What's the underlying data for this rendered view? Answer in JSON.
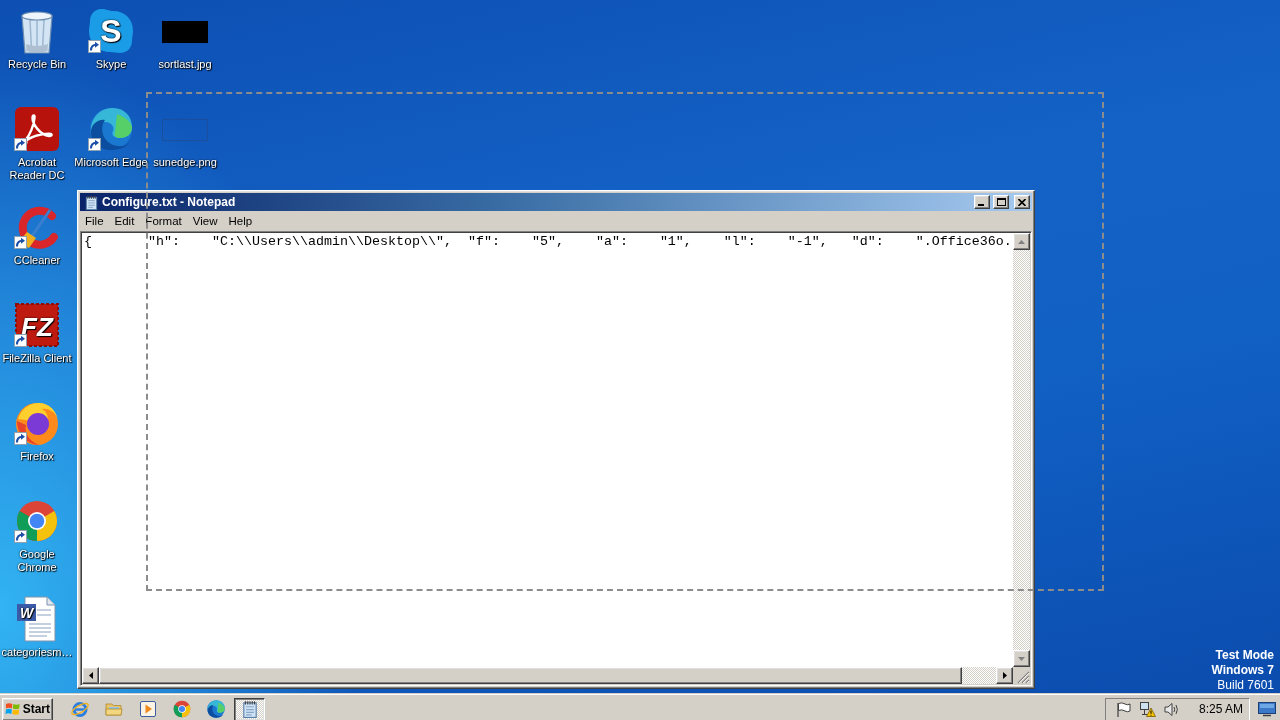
{
  "desktop": {
    "icon_columns": [
      [
        {
          "label": "Recycle Bin",
          "kind": "recycle_bin",
          "shortcut": false
        },
        {
          "label": "Acrobat Reader DC",
          "kind": "acrobat",
          "shortcut": true
        },
        {
          "label": "CCleaner",
          "kind": "ccleaner",
          "shortcut": true
        },
        {
          "label": "FileZilla Client",
          "kind": "filezilla",
          "logo_text": "FZ",
          "shortcut": true
        },
        {
          "label": "Firefox",
          "kind": "firefox",
          "shortcut": true
        },
        {
          "label": "Google Chrome",
          "kind": "chrome",
          "shortcut": true
        },
        {
          "label": "categoriesm…",
          "kind": "word_document",
          "logo_text": "W",
          "shortcut": false
        }
      ],
      [
        {
          "label": "Skype",
          "kind": "skype",
          "logo_text": "S",
          "shortcut": true
        },
        {
          "label": "Microsoft Edge",
          "kind": "edge",
          "shortcut": true
        }
      ],
      [
        {
          "label": "sortlast.jpg",
          "kind": "image_dark",
          "shortcut": false
        },
        {
          "label": "sunedge.png",
          "kind": "image_blank",
          "shortcut": false
        }
      ]
    ],
    "system_notice": [
      {
        "text": "Test Mode",
        "bold": true
      },
      {
        "text": "Windows 7",
        "bold": true
      },
      {
        "text": "Build 7601",
        "bold": false
      }
    ]
  },
  "window": {
    "title": "Configure.txt - Notepad",
    "menu": [
      "File",
      "Edit",
      "Format",
      "View",
      "Help"
    ],
    "content": "{\t\"h\":\t\"C:\\\\Users\\\\admin\\\\Desktop\\\\\",\t\"f\":\t\"5\",\t\"a\":\t\"1\",\t\"l\":\t\"-1\",\t\"d\":\t\".Office36o."
  },
  "taskbar": {
    "start_label": "Start",
    "task_buttons": [
      {
        "selected": true
      }
    ],
    "clock": "8:25 AM"
  }
}
